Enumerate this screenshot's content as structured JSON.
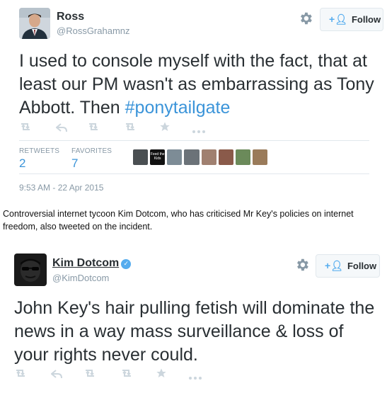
{
  "tweet1": {
    "display_name": "Ross",
    "handle": "@RossGrahamnz",
    "follow_label": "Follow",
    "text": "I used to console myself with the fact, that at least our PM wasn't as embarrassing as Tony Abbott. Then ",
    "hashtag": "#ponytailgate",
    "stats": {
      "retweets_label": "RETWEETS",
      "retweets_value": "2",
      "favorites_label": "FAVORITES",
      "favorites_value": "7"
    },
    "feed_kids_text": "Feed the Kids",
    "timestamp": "9:53 AM - 22 Apr 2015"
  },
  "caption": "Controversial internet tycoon Kim Dotcom, who has criticised Mr Key's policies on internet freedom, also tweeted on the incident.",
  "tweet2": {
    "display_name": "Kim Dotcom",
    "handle": "@KimDotcom",
    "follow_label": "Follow",
    "text": "John Key's hair pulling fetish will dominate the news in a way mass surveillance & loss of your rights never could."
  },
  "icons": {
    "gear": "gear-icon",
    "follow": "add-person-icon",
    "reply": "reply-icon",
    "retweet": "retweet-icon",
    "favorite": "star-icon",
    "more": "more-icon",
    "verified": "verified-badge-icon"
  },
  "colors": {
    "link": "#3b94d9",
    "accent": "#55acee",
    "muted": "#8899a6",
    "text": "#292f33"
  }
}
